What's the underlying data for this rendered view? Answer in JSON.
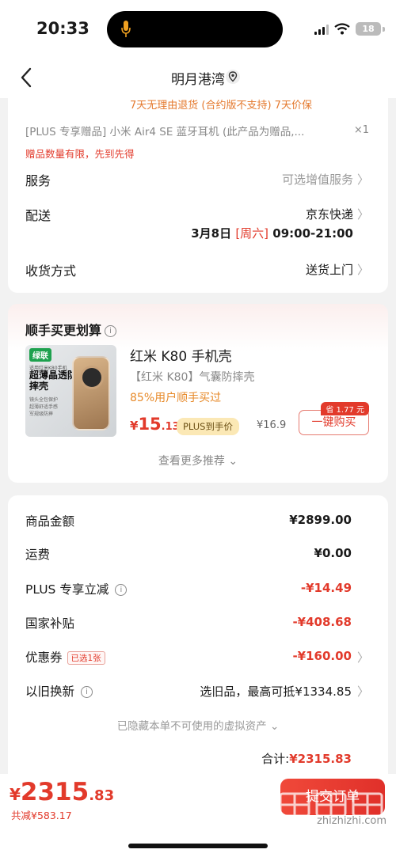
{
  "status": {
    "time": "20:33",
    "battery": "18"
  },
  "nav": {
    "title": "明月港湾"
  },
  "card1": {
    "promise": "7天无理由退货 (合约版不支持)   7天价保",
    "gift": "[PLUS 专享赠品] 小米 Air4 SE 蓝牙耳机 (此产品为赠品,...",
    "gift_qty": "×1",
    "gift_limit": "赠品数量有限，先到先得",
    "service_label": "服务",
    "service_value": "可选增值服务",
    "delivery_label": "配送",
    "delivery_value": "京东快递",
    "delivery_time_pre": "3月8日 ",
    "delivery_weekday": "[周六]",
    "delivery_time_post": " 09:00-21:00",
    "receive_label": "收货方式",
    "receive_value": "送货上门"
  },
  "card2": {
    "title": "顺手买更划算",
    "product": {
      "brand_tag": "绿联",
      "img_line1": "适用红米K80手机",
      "img_slogan": "超薄晶透防摔壳",
      "img_small": "镜头全包保护 超薄舒适手感 军规级防摔",
      "name": "红米 K80 手机壳",
      "desc": "【红米 K80】气囊防摔壳",
      "pct": "85%用户顺手买过",
      "price_cur": "¥",
      "price_int": "15",
      "price_dec": ".13",
      "plus_tag": "PLUS到手价",
      "orig_price": "¥16.9",
      "save_badge": "省 1.77 元",
      "buy_label": "一键购买"
    },
    "more": "查看更多推荐 ⌄"
  },
  "summary": {
    "rows": [
      {
        "label": "商品金额",
        "value": "¥2899.00"
      },
      {
        "label": "运费",
        "value": "¥0.00"
      },
      {
        "label": "PLUS 专享立减",
        "value": "-¥14.49"
      },
      {
        "label": "国家补贴",
        "value": "-¥408.68"
      },
      {
        "label": "优惠券",
        "value": "-¥160.00",
        "tag": "已选1张"
      },
      {
        "label": "以旧换新",
        "value": "选旧品，最高可抵¥1334.85"
      }
    ],
    "hidden_assets": "已隐藏本单不可使用的虚拟资产 ⌄",
    "total_label": "合计:",
    "total_value": "¥2315.83"
  },
  "bottom": {
    "price_cur": "¥",
    "price_int": "2315",
    "price_dec": ".83",
    "saved": "共减¥583.17",
    "submit": "提交订单",
    "watermark": "zhizhizhi.com"
  },
  "colors": {
    "accent": "#e23a2b",
    "orange": "#e78a2a",
    "plus_gold": "#fbe8b5"
  }
}
